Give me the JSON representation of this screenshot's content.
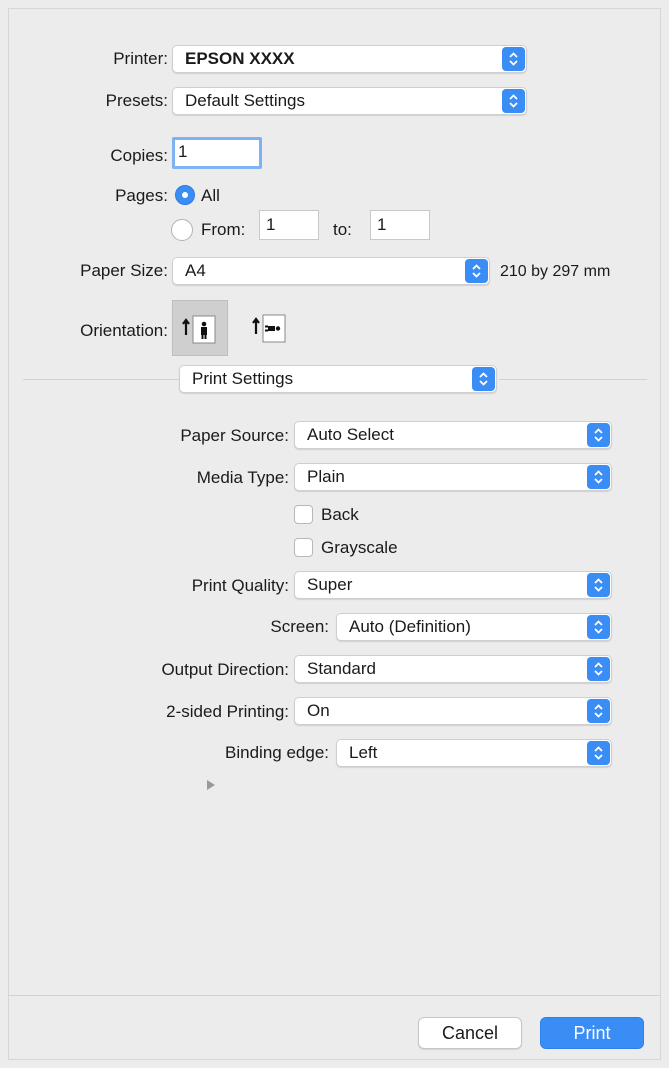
{
  "printer": {
    "label": "Printer:",
    "value": "EPSON XXXX"
  },
  "presets": {
    "label": "Presets:",
    "value": "Default Settings"
  },
  "copies": {
    "label": "Copies:",
    "value": "1"
  },
  "pages": {
    "label": "Pages:",
    "all_label": "All",
    "from_label": "From:",
    "from_value": "1",
    "to_label": "to:",
    "to_value": "1",
    "selected": "All"
  },
  "paper_size": {
    "label": "Paper Size:",
    "value": "A4",
    "dimensions": "210 by 297 mm"
  },
  "orientation": {
    "label": "Orientation:",
    "selected": "portrait"
  },
  "section_popup": {
    "value": "Print Settings"
  },
  "settings": {
    "paper_source": {
      "label": "Paper Source:",
      "value": "Auto Select"
    },
    "media_type": {
      "label": "Media Type:",
      "value": "Plain"
    },
    "back": {
      "label": "Back",
      "checked": false
    },
    "grayscale": {
      "label": "Grayscale",
      "checked": false
    },
    "print_quality": {
      "label": "Print Quality:",
      "value": "Super"
    },
    "screen": {
      "label": "Screen:",
      "value": "Auto (Definition)"
    },
    "output_direction": {
      "label": "Output Direction:",
      "value": "Standard"
    },
    "two_sided": {
      "label": "2-sided Printing:",
      "value": "On"
    },
    "binding_edge": {
      "label": "Binding edge:",
      "value": "Left"
    }
  },
  "buttons": {
    "cancel": "Cancel",
    "print": "Print"
  },
  "colors": {
    "accent": "#3a8df5",
    "background": "#ececec"
  },
  "icons": {
    "stepper": "up-down-chevron-icon",
    "disclosure": "disclosure-triangle-icon",
    "portrait": "portrait-orientation-icon",
    "landscape": "landscape-orientation-icon"
  }
}
